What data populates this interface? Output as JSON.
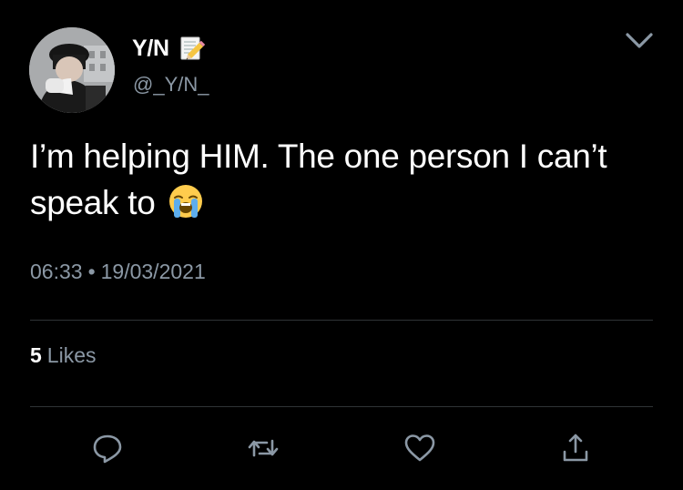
{
  "author": {
    "display_name": "Y/N",
    "handle": "@_Y/N_",
    "name_emoji": "memo-icon"
  },
  "tweet": {
    "text": "I’m helping HIM. The one person I can’t speak to",
    "emoji": "loudly-crying-face-icon",
    "time": "06:33",
    "separator": "•",
    "date": "19/03/2021"
  },
  "stats": {
    "likes_count": "5",
    "likes_label": "Likes"
  },
  "actions": [
    "reply-icon",
    "retweet-icon",
    "like-icon",
    "share-icon"
  ],
  "colors": {
    "background": "#000000",
    "text": "#ffffff",
    "secondary": "#8b98a5",
    "divider": "#2f3336"
  }
}
